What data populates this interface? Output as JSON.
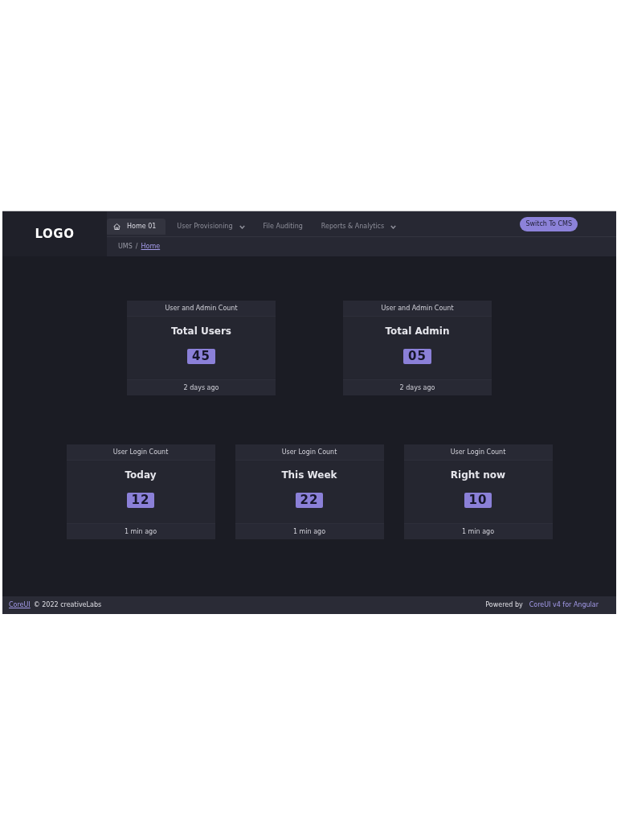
{
  "header": {
    "logo": "LOGO",
    "nav": [
      {
        "label": "Home 01",
        "kind": "home",
        "selected": true
      },
      {
        "label": "User Provisioning",
        "kind": "dropdown",
        "selected": false
      },
      {
        "label": "File Auditing",
        "kind": "link",
        "selected": false
      },
      {
        "label": "Reports & Analytics",
        "kind": "dropdown",
        "selected": false
      }
    ],
    "action_button": "Switch To CMS"
  },
  "breadcrumb": {
    "separator": "/",
    "items": [
      {
        "label": "UMS",
        "link": false
      },
      {
        "label": "Home",
        "link": true
      }
    ]
  },
  "card_rows": [
    [
      {
        "header": "User and Admin Count",
        "title": "Total Users",
        "value": "45",
        "footer": "2 days ago"
      },
      {
        "header": "User and Admin Count",
        "title": "Total Admin",
        "value": "05",
        "footer": "2 days ago"
      }
    ],
    [
      {
        "header": "User Login Count",
        "title": "Today",
        "value": "12",
        "footer": "1 min ago"
      },
      {
        "header": "User Login Count",
        "title": "This Week",
        "value": "22",
        "footer": "1 min ago"
      },
      {
        "header": "User Login Count",
        "title": "Right now",
        "value": "10",
        "footer": "1 min ago"
      }
    ]
  ],
  "footer": {
    "left_link": "CoreUI",
    "left_text": "© 2022 creativeLabs",
    "right_text": "Powered by",
    "right_link": "CoreUI v4 for Angular"
  }
}
